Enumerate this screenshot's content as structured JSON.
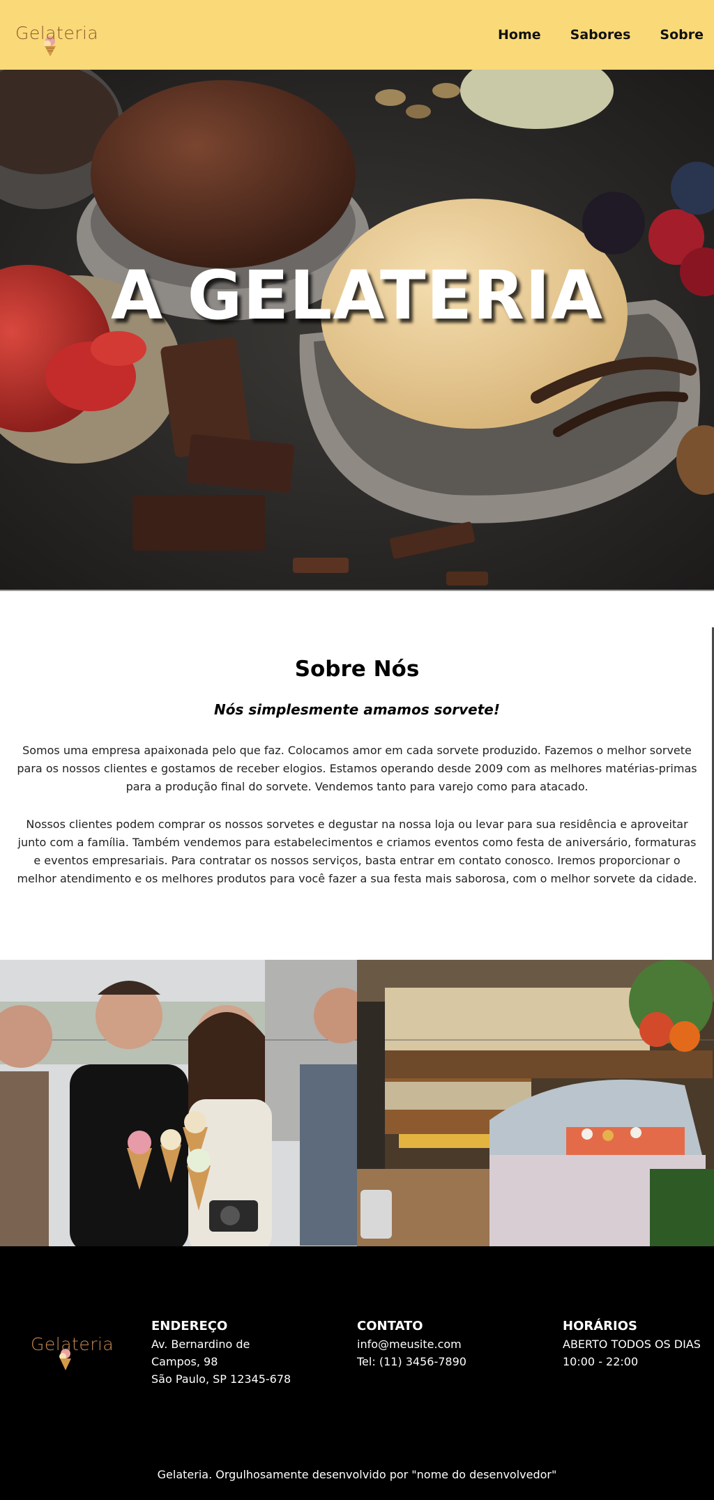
{
  "brand": {
    "logo_text": "Gelateria"
  },
  "nav": {
    "items": [
      {
        "label": "Home"
      },
      {
        "label": "Sabores"
      },
      {
        "label": "Sobre"
      }
    ]
  },
  "hero": {
    "title": "A GELATERIA"
  },
  "about": {
    "title": "Sobre Nós",
    "subtitle": "Nós simplesmente amamos sorvete!",
    "paragraphs": [
      "Somos uma empresa apaixonada pelo que faz. Colocamos amor em cada sorvete produzido. Fazemos o melhor sorvete para os nossos clientes e gostamos de receber elogios. Estamos operando desde 2009 com as melhores matérias-primas para a produção final do sorvete. Vendemos tanto para varejo como para atacado.",
      "Nossos clientes podem comprar os nossos sorvetes e degustar na nossa loja ou levar para sua residência e aproveitar junto com a família. Também vendemos para estabelecimentos e criamos eventos como festa de aniversário, formaturas e eventos empresariais. Para contratar os nossos serviços, basta entrar em contato conosco. Iremos proporcionar o melhor atendimento e os melhores produtos para você fazer a sua festa mais saborosa, com o melhor sorvete da cidade."
    ]
  },
  "footer": {
    "address": {
      "title": "Endereço",
      "lines": [
        "Av. Bernardino de",
        "Campos, 98",
        "São Paulo, SP 12345-678"
      ]
    },
    "contact": {
      "title": "Contato",
      "email": "info@meusite.com",
      "phone": "Tel: (11) 3456-7890"
    },
    "hours": {
      "title": "Horários",
      "lines": [
        "ABERTO TODOS OS DIAS",
        "10:00 - 22:00"
      ]
    },
    "copyright": "Gelateria. Orgulhosamente desenvolvido por \"nome do desenvolvedor\""
  },
  "colors": {
    "header_bg": "#fad978",
    "footer_bg": "#000000",
    "logo_brown": "#8b5a2b"
  }
}
